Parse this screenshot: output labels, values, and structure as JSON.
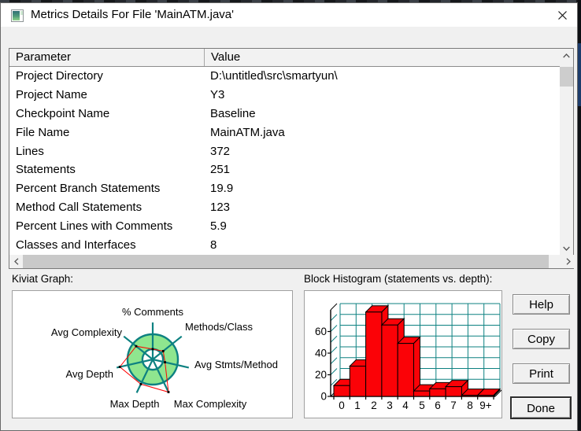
{
  "window": {
    "title": "Metrics Details For File 'MainATM.java'"
  },
  "table": {
    "columns": [
      "Parameter",
      "Value"
    ],
    "rows": [
      {
        "param": "Project Directory",
        "value": "D:\\untitled\\src\\smartyun\\"
      },
      {
        "param": "Project Name",
        "value": "Y3"
      },
      {
        "param": "Checkpoint Name",
        "value": "Baseline"
      },
      {
        "param": "File Name",
        "value": "MainATM.java"
      },
      {
        "param": "Lines",
        "value": "372"
      },
      {
        "param": "Statements",
        "value": "251"
      },
      {
        "param": "Percent Branch Statements",
        "value": "19.9"
      },
      {
        "param": "Method Call Statements",
        "value": "123"
      },
      {
        "param": "Percent Lines with Comments",
        "value": "5.9"
      },
      {
        "param": "Classes and Interfaces",
        "value": "8"
      }
    ]
  },
  "buttons": {
    "help": "Help",
    "copy": "Copy",
    "print": "Print",
    "done": "Done"
  },
  "chart_data": [
    {
      "type": "radar",
      "title": "Kiviat Graph:",
      "axes": [
        "% Comments",
        "Methods/Class",
        "Avg Stmts/Method",
        "Max Complexity",
        "Max Depth",
        "Avg Depth",
        "Avg Complexity"
      ],
      "values_ring_fraction": [
        0.41,
        0.53,
        0.5,
        1.44,
        1.09,
        1.34,
        0.84
      ],
      "ring_inner_fraction": 0.41,
      "ring_fill": "#8fe68f",
      "axis_color": "#0d8181",
      "line_color": "#ff0000",
      "point_color": "#000000"
    },
    {
      "type": "bar",
      "title": "Block Histogram (statements vs. depth):",
      "categories": [
        "0",
        "1",
        "2",
        "3",
        "4",
        "5",
        "6",
        "7",
        "8",
        "9+"
      ],
      "values": [
        10,
        28,
        78,
        66,
        49,
        5,
        7,
        9,
        1,
        1
      ],
      "yticks": [
        "0",
        "20",
        "40",
        "60"
      ],
      "ylim": [
        0,
        80
      ],
      "bar_color": "#fb0207",
      "grid_color": "#0d8181",
      "style": "3d",
      "legend": "none"
    }
  ]
}
